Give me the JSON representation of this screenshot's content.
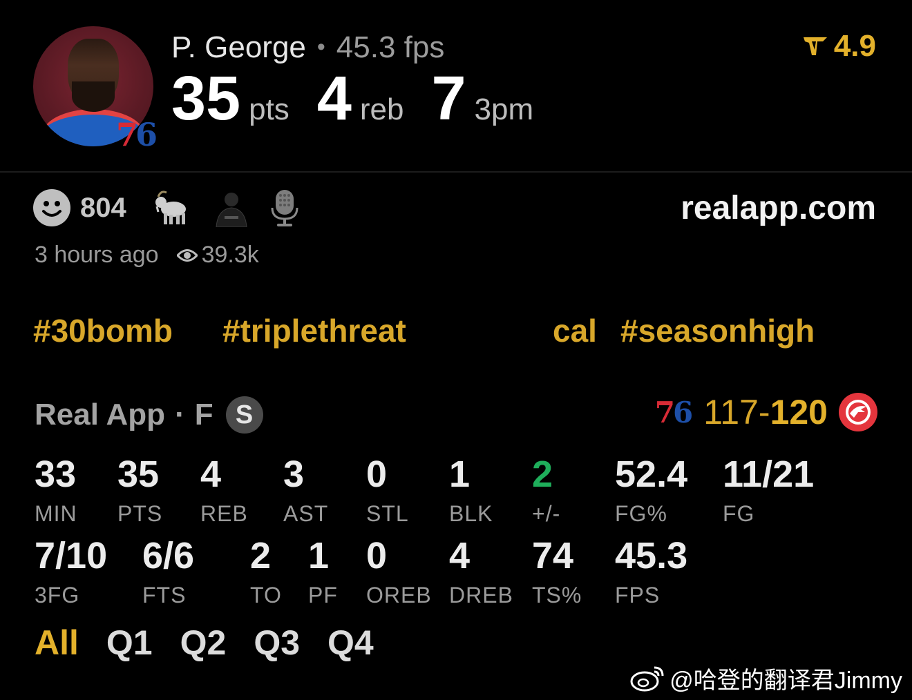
{
  "player": {
    "name": "P. George",
    "fps": "45.3 fps",
    "team_badge": "76",
    "points": "35",
    "points_unit": "pts",
    "rebounds": "4",
    "rebounds_unit": "reb",
    "threes": "7",
    "threes_unit": "3pm"
  },
  "rating": {
    "value": "4.9",
    "icon": "real-logo-icon",
    "color": "#e3b12b"
  },
  "reactions": {
    "count": "804",
    "icons": [
      "smile-icon",
      "goat-icon",
      "player-emoji-icon",
      "microphone-icon"
    ]
  },
  "site": "realapp.com",
  "meta": {
    "time_ago": "3 hours ago",
    "views": "39.3k"
  },
  "hashtags": [
    "#30bomb",
    "#triplethreat",
    "cal",
    "#seasonhigh"
  ],
  "game": {
    "source": "Real App",
    "status": "F",
    "badge": "S",
    "home_score": "117",
    "away_score": "120",
    "home_logo": "76",
    "away_logo": "hawks-logo-icon"
  },
  "stats_row1": [
    {
      "value": "33",
      "label": "MIN"
    },
    {
      "value": "35",
      "label": "PTS"
    },
    {
      "value": "4",
      "label": "REB"
    },
    {
      "value": "3",
      "label": "AST"
    },
    {
      "value": "0",
      "label": "STL"
    },
    {
      "value": "1",
      "label": "BLK"
    },
    {
      "value": "2",
      "label": "+/-"
    },
    {
      "value": "52.4",
      "label": "FG%"
    },
    {
      "value": "11/21",
      "label": "FG"
    }
  ],
  "stats_row2": [
    {
      "value": "7/10",
      "label": "3FG"
    },
    {
      "value": "6/6",
      "label": "FTS"
    },
    {
      "value": "2",
      "label": "TO"
    },
    {
      "value": "1",
      "label": "PF"
    },
    {
      "value": "0",
      "label": "OREB"
    },
    {
      "value": "4",
      "label": "DREB"
    },
    {
      "value": "74",
      "label": "TS%"
    },
    {
      "value": "45.3",
      "label": "FPS"
    }
  ],
  "quarters": [
    "All",
    "Q1",
    "Q2",
    "Q3",
    "Q4"
  ],
  "watermark": "@哈登的翻译君Jimmy",
  "colors": {
    "accent": "#e3b12b",
    "positive": "#1fae5b",
    "background": "#000000"
  }
}
